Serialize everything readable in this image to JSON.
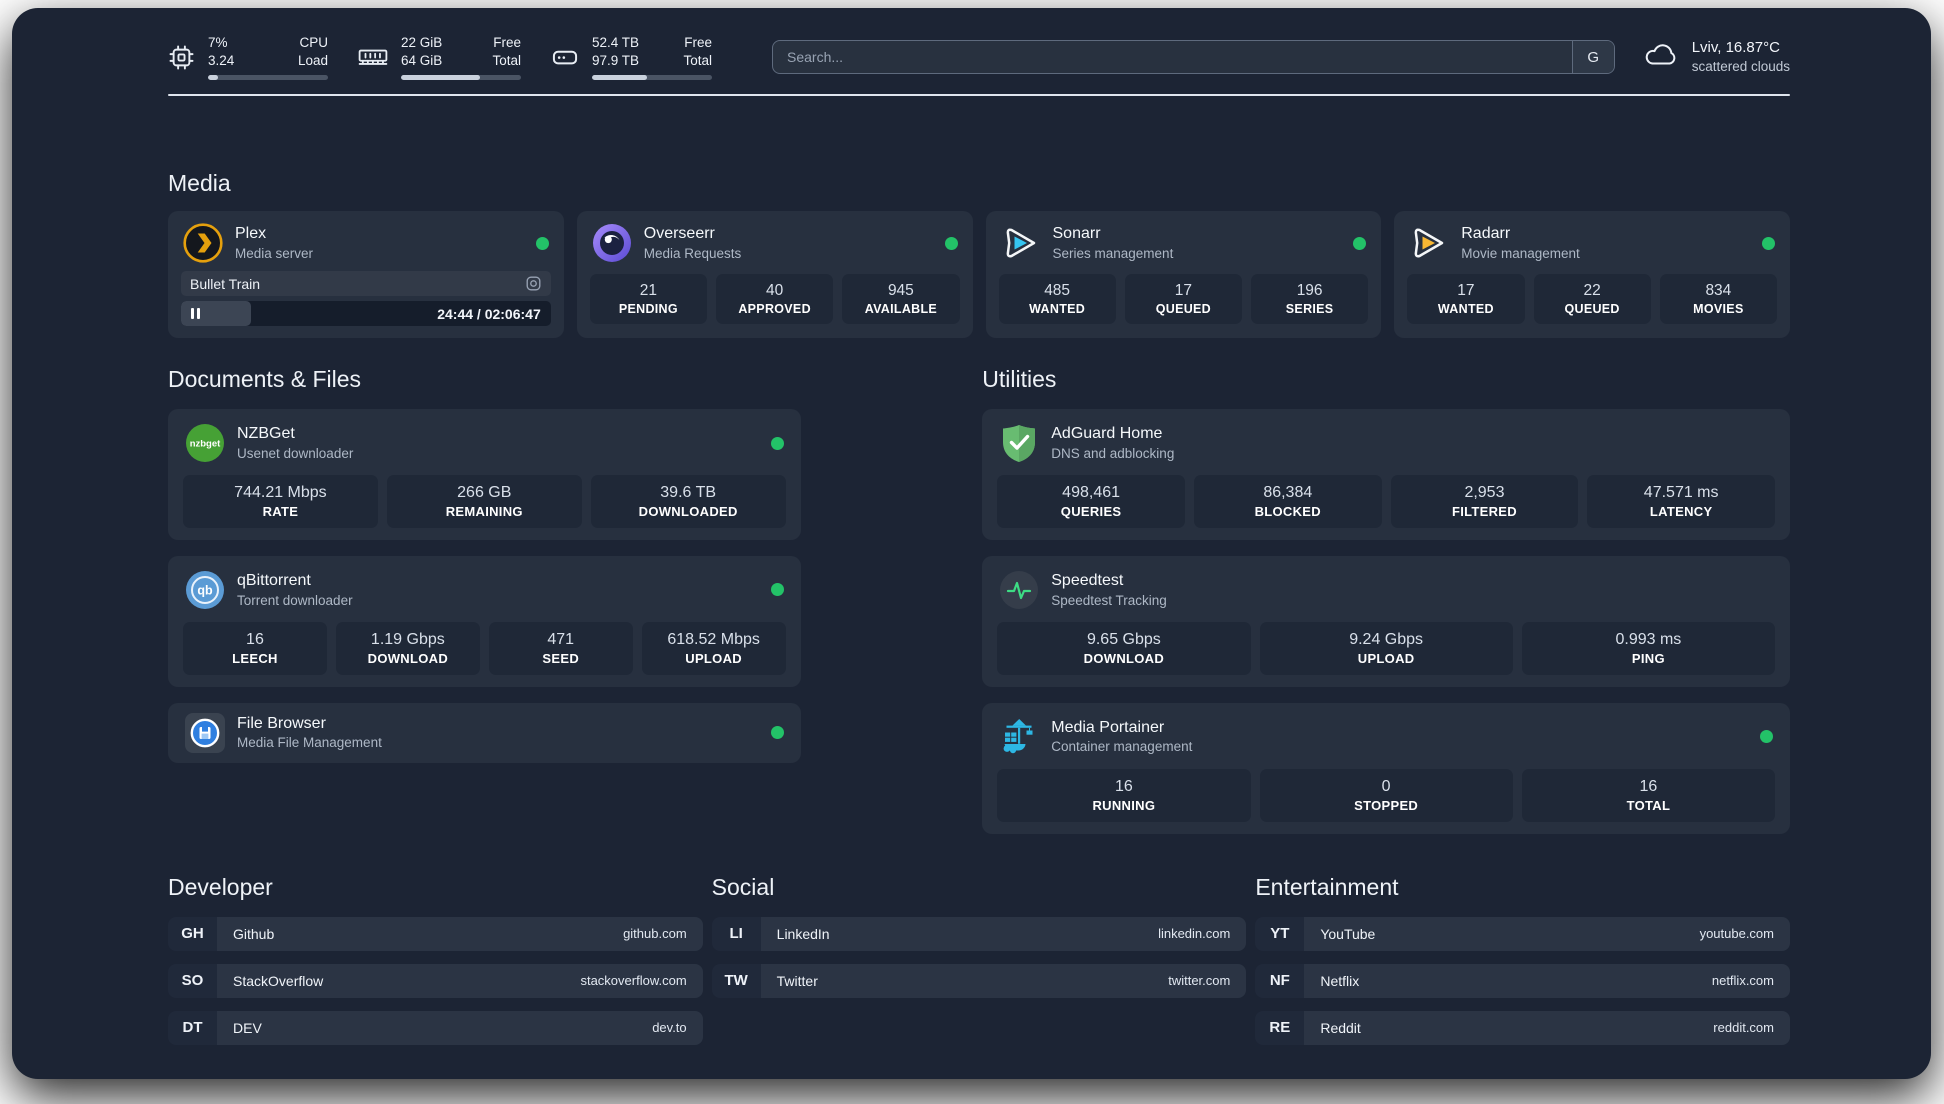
{
  "header": {
    "metrics": [
      {
        "icon": "cpu-icon",
        "values": [
          "7%",
          "3.24"
        ],
        "labels": [
          "CPU",
          "Load"
        ],
        "progress": 8
      },
      {
        "icon": "ram-icon",
        "values": [
          "22 GiB",
          "64 GiB"
        ],
        "labels": [
          "Free",
          "Total"
        ],
        "progress": 66
      },
      {
        "icon": "disk-icon",
        "values": [
          "52.4 TB",
          "97.9 TB"
        ],
        "labels": [
          "Free",
          "Total"
        ],
        "progress": 46
      }
    ],
    "search": {
      "placeholder": "Search...",
      "button_label": "G"
    },
    "weather": {
      "location": "Lviv, 16.87°C",
      "condition": "scattered clouds"
    }
  },
  "media": {
    "title": "Media",
    "plex": {
      "name": "Plex",
      "description": "Media server",
      "now_playing": "Bullet Train",
      "time": "24:44 / 02:06:47",
      "progress": 19
    },
    "apps": [
      {
        "name": "Overseerr",
        "description": "Media Requests",
        "stats": [
          {
            "value": "21",
            "label": "PENDING"
          },
          {
            "value": "40",
            "label": "APPROVED"
          },
          {
            "value": "945",
            "label": "AVAILABLE"
          }
        ]
      },
      {
        "name": "Sonarr",
        "description": "Series management",
        "stats": [
          {
            "value": "485",
            "label": "WANTED"
          },
          {
            "value": "17",
            "label": "QUEUED"
          },
          {
            "value": "196",
            "label": "SERIES"
          }
        ]
      },
      {
        "name": "Radarr",
        "description": "Movie management",
        "stats": [
          {
            "value": "17",
            "label": "WANTED"
          },
          {
            "value": "22",
            "label": "QUEUED"
          },
          {
            "value": "834",
            "label": "MOVIES"
          }
        ]
      }
    ]
  },
  "documents": {
    "title": "Documents & Files",
    "apps": [
      {
        "name": "NZBGet",
        "description": "Usenet downloader",
        "stats": [
          {
            "value": "744.21 Mbps",
            "label": "RATE"
          },
          {
            "value": "266 GB",
            "label": "REMAINING"
          },
          {
            "value": "39.6 TB",
            "label": "DOWNLOADED"
          }
        ]
      },
      {
        "name": "qBittorrent",
        "description": "Torrent downloader",
        "stats": [
          {
            "value": "16",
            "label": "LEECH"
          },
          {
            "value": "1.19 Gbps",
            "label": "DOWNLOAD"
          },
          {
            "value": "471",
            "label": "SEED"
          },
          {
            "value": "618.52 Mbps",
            "label": "UPLOAD"
          }
        ]
      },
      {
        "name": "File Browser",
        "description": "Media File Management",
        "stats": []
      }
    ]
  },
  "utilities": {
    "title": "Utilities",
    "apps": [
      {
        "name": "AdGuard Home",
        "description": "DNS and adblocking",
        "stats": [
          {
            "value": "498,461",
            "label": "QUERIES"
          },
          {
            "value": "86,384",
            "label": "BLOCKED"
          },
          {
            "value": "2,953",
            "label": "FILTERED"
          },
          {
            "value": "47.571 ms",
            "label": "LATENCY"
          }
        ]
      },
      {
        "name": "Speedtest",
        "description": "Speedtest Tracking",
        "stats": [
          {
            "value": "9.65 Gbps",
            "label": "DOWNLOAD"
          },
          {
            "value": "9.24 Gbps",
            "label": "UPLOAD"
          },
          {
            "value": "0.993 ms",
            "label": "PING"
          }
        ]
      },
      {
        "name": "Media Portainer",
        "description": "Container management",
        "stats": [
          {
            "value": "16",
            "label": "RUNNING"
          },
          {
            "value": "0",
            "label": "STOPPED"
          },
          {
            "value": "16",
            "label": "TOTAL"
          }
        ]
      }
    ]
  },
  "links": {
    "developer": {
      "title": "Developer",
      "items": [
        {
          "tag": "GH",
          "name": "Github",
          "url": "github.com"
        },
        {
          "tag": "SO",
          "name": "StackOverflow",
          "url": "stackoverflow.com"
        },
        {
          "tag": "DT",
          "name": "DEV",
          "url": "dev.to"
        }
      ]
    },
    "social": {
      "title": "Social",
      "items": [
        {
          "tag": "LI",
          "name": "LinkedIn",
          "url": "linkedin.com"
        },
        {
          "tag": "TW",
          "name": "Twitter",
          "url": "twitter.com"
        }
      ]
    },
    "entertainment": {
      "title": "Entertainment",
      "items": [
        {
          "tag": "YT",
          "name": "YouTube",
          "url": "youtube.com"
        },
        {
          "tag": "NF",
          "name": "Netflix",
          "url": "netflix.com"
        },
        {
          "tag": "RE",
          "name": "Reddit",
          "url": "reddit.com"
        }
      ]
    }
  },
  "colors": {
    "status_online": "#23c268",
    "plex": "#e5a00d",
    "sonarr": "#35c5f1",
    "radarr": "#f8b733",
    "nzbget": "#46a135",
    "qbittorrent": "#5b9bd5",
    "adguard": "#68bc71",
    "speedtest": "#3ddc84",
    "portainer": "#2db7e4",
    "filebrowser": "#2f7fe0"
  }
}
